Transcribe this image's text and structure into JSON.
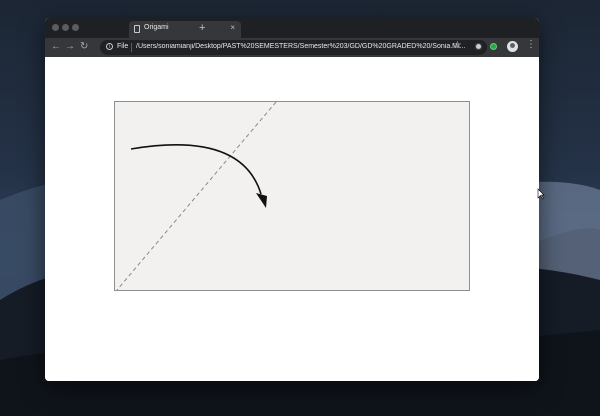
{
  "browser": {
    "tab_title": "Origami",
    "tab_close": "×",
    "new_tab": "+",
    "nav": {
      "back": "←",
      "forward": "→",
      "reload": "↻"
    },
    "omnibox": {
      "info_icon": "i",
      "scheme": "File",
      "url": "/Users/soniamianji/Desktop/PAST%20SEMESTERS/Semester%203/GD/GD%20GRADED%20/Sonia.Mi..."
    },
    "star": "☆",
    "menu": "⋮"
  },
  "colors": {
    "paper": "#f3f1f0",
    "fold_line": "#8a8a8a",
    "arrow": "#111111",
    "tab_bar": "#1f2023",
    "toolbar": "#36373a"
  },
  "icons": [
    "page-icon",
    "close-icon",
    "plus-icon",
    "back-arrow-icon",
    "forward-arrow-icon",
    "reload-icon",
    "info-icon",
    "star-icon",
    "extension-icon",
    "extension-green-icon",
    "avatar-icon",
    "menu-icon",
    "fold-arrow-icon",
    "cursor-icon"
  ]
}
